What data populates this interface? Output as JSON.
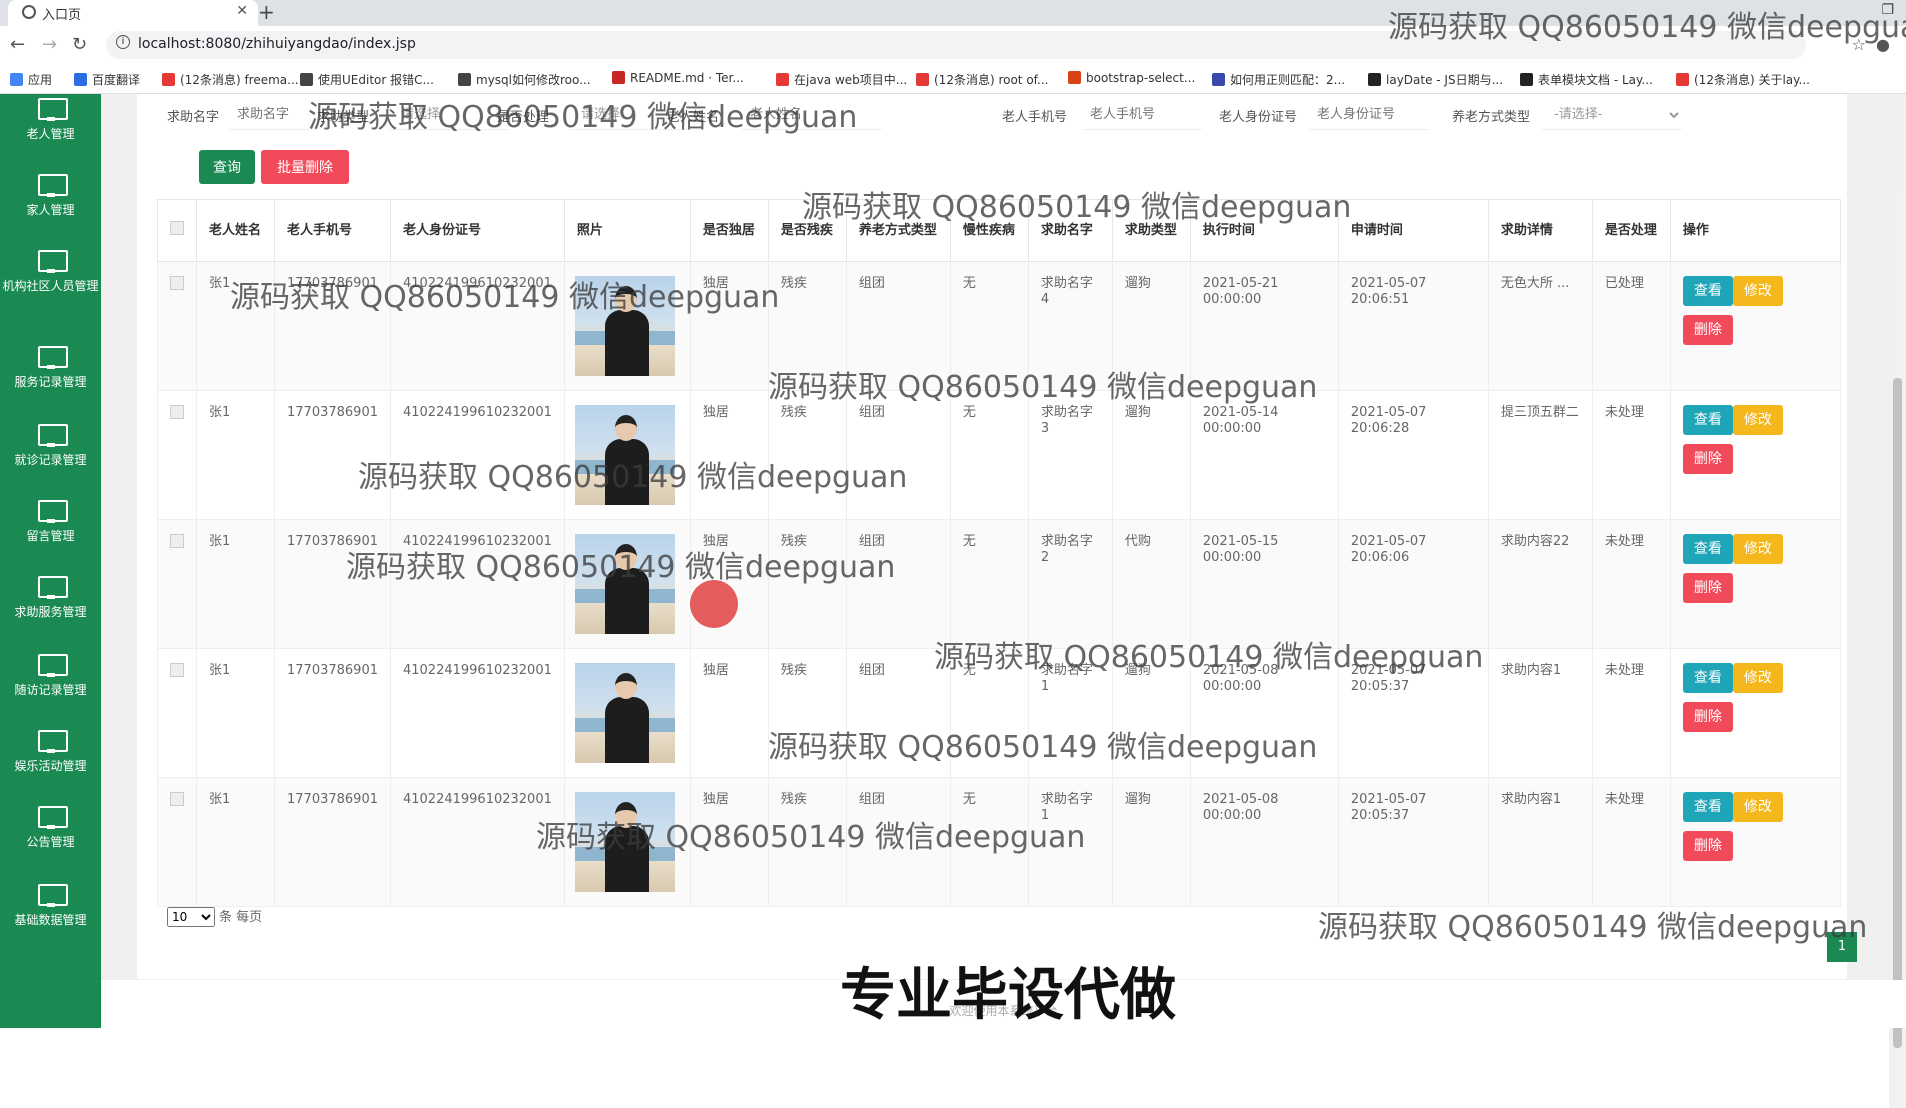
{
  "browser": {
    "tab_title": "入口页",
    "url": "localhost:8080/zhihuiyangdao/index.jsp",
    "bookmarks": [
      {
        "label": "应用",
        "color": "#4285f4"
      },
      {
        "label": "百度翻译",
        "color": "#2b6de2"
      },
      {
        "label": "(12条消息) freema...",
        "color": "#e53935"
      },
      {
        "label": "使用UEditor 报错C...",
        "color": "#444"
      },
      {
        "label": "mysql如何修改roo...",
        "color": "#444"
      },
      {
        "label": "README.md · Ter...",
        "color": "#c62828"
      },
      {
        "label": "在java web项目中...",
        "color": "#e53935"
      },
      {
        "label": "(12条消息) root of...",
        "color": "#e53935"
      },
      {
        "label": "bootstrap-select...",
        "color": "#d84315"
      },
      {
        "label": "如何用正则匹配：2...",
        "color": "#3949ab"
      },
      {
        "label": "layDate - JS日期与...",
        "color": "#222"
      },
      {
        "label": "表单模块文档 - Lay...",
        "color": "#222"
      },
      {
        "label": "(12条消息) 关于lay...",
        "color": "#e53935"
      }
    ]
  },
  "sidebar": [
    {
      "label": "老人管理"
    },
    {
      "label": "家人管理"
    },
    {
      "label": "机构社区人员管理"
    },
    {
      "label": "服务记录管理"
    },
    {
      "label": "就诊记录管理"
    },
    {
      "label": "留言管理"
    },
    {
      "label": "求助服务管理"
    },
    {
      "label": "随访记录管理"
    },
    {
      "label": "娱乐活动管理"
    },
    {
      "label": "公告管理"
    },
    {
      "label": "基础数据管理"
    }
  ],
  "search": {
    "f1_label": "求助名字",
    "f1_ph": "求助名字",
    "f2_label": "求助类型",
    "f2_val": "请选择",
    "f3_label": "是否处理",
    "f3_val": "请选择",
    "f4_label": "老人姓名",
    "f4_ph": "老人姓名",
    "f5_label": "老人手机号",
    "f5_ph": "老人手机号",
    "f6_label": "老人身份证号",
    "f6_ph": "老人身份证号",
    "f7_label": "养老方式类型",
    "f7_val": "-请选择-",
    "query_btn": "查询",
    "batch_delete_btn": "批量删除"
  },
  "table": {
    "headers": [
      "老人姓名",
      "老人手机号",
      "老人身份证号",
      "照片",
      "是否独居",
      "是否残疾",
      "养老方式类型",
      "慢性疾病",
      "求助名字",
      "求助类型",
      "执行时间",
      "申请时间",
      "求助详情",
      "是否处理",
      "操作"
    ],
    "rows": [
      {
        "name": "张1",
        "phone": "17703786901",
        "id": "410224199610232001",
        "alone": "独居",
        "disabled": "残疾",
        "mode": "组团",
        "chronic": "无",
        "help_name": "求助名字4",
        "help_type": "遛狗",
        "exec_time": "2021-05-21 00:00:00",
        "apply_time": "2021-05-07 20:06:51",
        "detail": "无色大所 ...",
        "status": "已处理"
      },
      {
        "name": "张1",
        "phone": "17703786901",
        "id": "410224199610232001",
        "alone": "独居",
        "disabled": "残疾",
        "mode": "组团",
        "chronic": "无",
        "help_name": "求助名字3",
        "help_type": "遛狗",
        "exec_time": "2021-05-14 00:00:00",
        "apply_time": "2021-05-07 20:06:28",
        "detail": "提三顶五群二",
        "status": "未处理"
      },
      {
        "name": "张1",
        "phone": "17703786901",
        "id": "410224199610232001",
        "alone": "独居",
        "disabled": "残疾",
        "mode": "组团",
        "chronic": "无",
        "help_name": "求助名字2",
        "help_type": "代购",
        "exec_time": "2021-05-15 00:00:00",
        "apply_time": "2021-05-07 20:06:06",
        "detail": "求助内容22",
        "status": "未处理"
      },
      {
        "name": "张1",
        "phone": "17703786901",
        "id": "410224199610232001",
        "alone": "独居",
        "disabled": "残疾",
        "mode": "组团",
        "chronic": "无",
        "help_name": "求助名字1",
        "help_type": "遛狗",
        "exec_time": "2021-05-08 00:00:00",
        "apply_time": "2021-05-07 20:05:37",
        "detail": "求助内容1",
        "status": "未处理"
      },
      {
        "name": "张1",
        "phone": "17703786901",
        "id": "410224199610232001",
        "alone": "独居",
        "disabled": "残疾",
        "mode": "组团",
        "chronic": "无",
        "help_name": "求助名字1",
        "help_type": "遛狗",
        "exec_time": "2021-05-08 00:00:00",
        "apply_time": "2021-05-07 20:05:37",
        "detail": "求助内容1",
        "status": "未处理"
      }
    ],
    "view_btn": "查看",
    "edit_btn": "修改",
    "delete_btn": "删除"
  },
  "pager": {
    "page_size": "10",
    "per_page_label": "条 每页",
    "current_page": "1"
  },
  "footer": {
    "text": "欢迎使用本系统平台"
  },
  "watermark": {
    "text": "源码获取 QQ86050149 微信deepguan",
    "big": "专业毕设代做"
  },
  "colors": {
    "sidebar": "#1b8a52",
    "query": "#1b8a52",
    "danger": "#f14b5b",
    "info": "#1ea5b8",
    "warn": "#f5b81c"
  }
}
